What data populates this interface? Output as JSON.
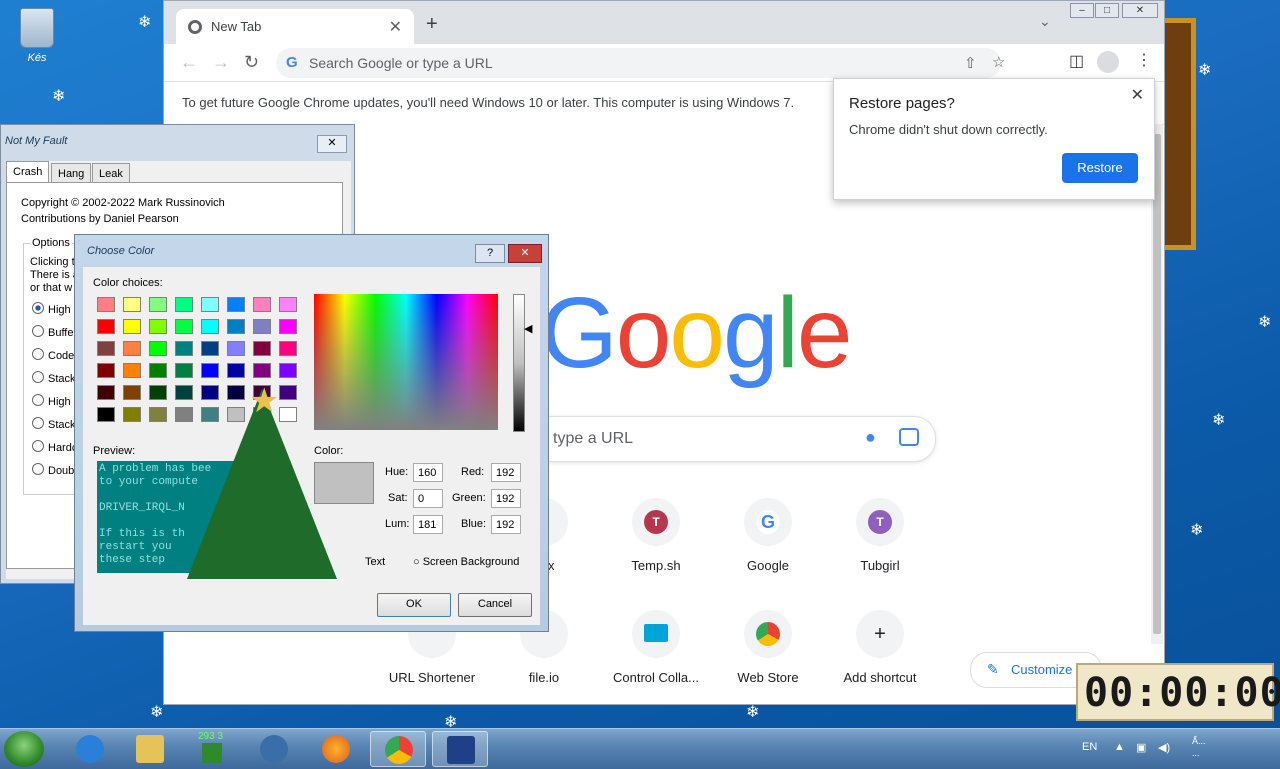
{
  "desktop": {
    "recycle_bin_label": "Kés",
    "snow_glyph": "❄"
  },
  "chrome": {
    "tab_title": "New Tab",
    "tab_close": "✕",
    "new_tab": "+",
    "omnibox_placeholder": "Search Google or type a URL",
    "omnibox_g": "G",
    "infobar_text": "To get future Google Chrome updates, you'll need Windows 10 or later. This computer is using Windows 7.",
    "logo": [
      "G",
      "o",
      "o",
      "g",
      "l",
      "e"
    ],
    "logo_colors": [
      "#4285f4",
      "#ea4335",
      "#fbbc05",
      "#4285f4",
      "#34a853",
      "#ea4335"
    ],
    "search_placeholder": "type a URL",
    "shortcuts": [
      {
        "label": "box",
        "letter": "",
        "color": "#f1f3f4"
      },
      {
        "label": "Temp.sh",
        "letter": "T",
        "color": "#b5364d"
      },
      {
        "label": "Google",
        "letter": "G",
        "color": "#ffffff"
      },
      {
        "label": "Tubgirl",
        "letter": "T",
        "color": "#8e5fbf"
      },
      {
        "label": "URL Shortener",
        "letter": "",
        "color": "#f1f3f4"
      },
      {
        "label": "file.io",
        "letter": "",
        "color": "#f1f3f4"
      },
      {
        "label": "Control Colla...",
        "letter": "",
        "color": "#00a4d6"
      },
      {
        "label": "Web Store",
        "letter": "",
        "color": "#f1f3f4"
      },
      {
        "label": "Add shortcut",
        "letter": "+",
        "color": "#f1f3f4"
      }
    ],
    "customize_label": "Customize C",
    "popup": {
      "title": "Restore pages?",
      "body": "Chrome didn't shut down correctly.",
      "button": "Restore",
      "close": "✕"
    },
    "accent": "#1a73e8"
  },
  "notmyfault": {
    "title": "Not My Fault",
    "close": "✕",
    "tabs": [
      "Crash",
      "Hang",
      "Leak"
    ],
    "copyright": "Copyright © 2002-2022 Mark Russinovich",
    "contrib": "Contributions by Daniel Pearson",
    "options_label": "Options",
    "desc1": "Clicking th",
    "desc2": "There is a",
    "desc3": "or that w",
    "radios": [
      "High I",
      "Buffer",
      "Code o",
      "Stack",
      "High II",
      "Stack",
      "Hardc",
      "Double"
    ]
  },
  "choose_color": {
    "title": "Choose Color",
    "help": "?",
    "close": "✕",
    "color_choices_label": "Color choices:",
    "swatches": [
      [
        "#ff8080",
        "#ffff80",
        "#80ff80",
        "#00ff80",
        "#80ffff",
        "#0080ff",
        "#ff80c0",
        "#ff80ff"
      ],
      [
        "#ff0000",
        "#ffff00",
        "#80ff00",
        "#00ff40",
        "#00ffff",
        "#0080c0",
        "#8080c0",
        "#ff00ff"
      ],
      [
        "#804040",
        "#ff8040",
        "#00ff00",
        "#008080",
        "#004080",
        "#8080ff",
        "#800040",
        "#ff0080"
      ],
      [
        "#800000",
        "#ff8000",
        "#008000",
        "#008040",
        "#0000ff",
        "#0000a0",
        "#800080",
        "#8000ff"
      ],
      [
        "#400000",
        "#804000",
        "#004000",
        "#004040",
        "#000080",
        "#000040",
        "#400040",
        "#400080"
      ],
      [
        "#000000",
        "#808000",
        "#808040",
        "#808080",
        "#408080",
        "#c0c0c0",
        "#400040",
        "#ffffff"
      ]
    ],
    "preview_label": "Preview:",
    "preview_text": "A problem has bee\nto your compute\n\nDRIVER_IRQL_N\n\nIf this is th\nrestart you\nthese step",
    "color_label": "Color:",
    "hue_label": "Hue:",
    "hue": "160",
    "sat_label": "Sat:",
    "sat": "0",
    "lum_label": "Lum:",
    "lum": "181",
    "red_label": "Red:",
    "red": "192",
    "green_label": "Green:",
    "green": "192",
    "blue_label": "Blue:",
    "blue": "192",
    "text_option": "Text",
    "screen_bg_option": "Screen Background",
    "ok": "OK",
    "cancel": "Cancel"
  },
  "taskbar": {
    "lang": "EN",
    "counter": "293 3",
    "clock_line1": "Ấ...",
    "clock_line2": "..."
  },
  "timer": {
    "display": "00:00:00"
  }
}
